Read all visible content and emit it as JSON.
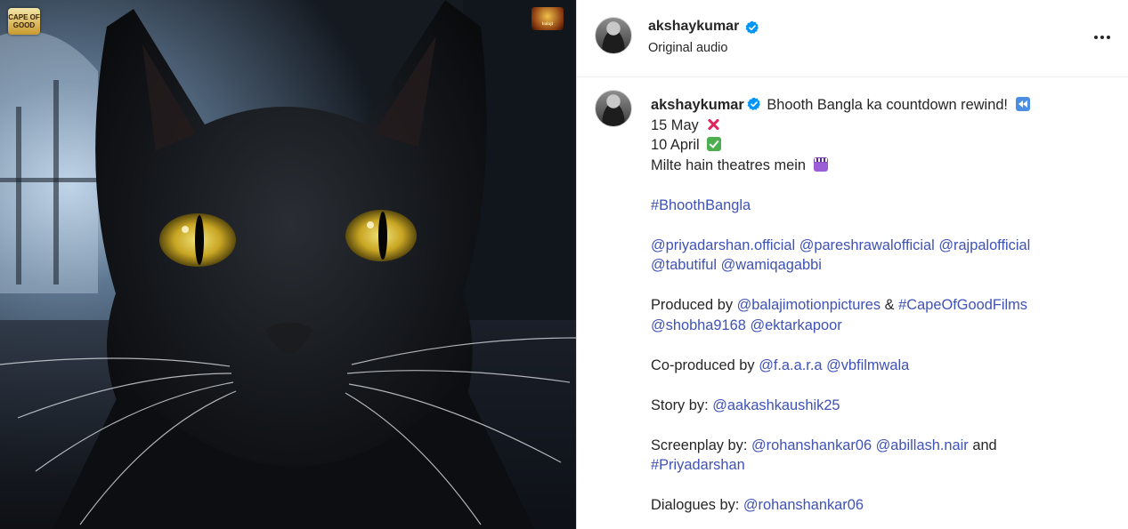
{
  "post": {
    "media": {
      "logo_left_text": "CAPE OF GOOD",
      "logo_right_text": "balaji"
    },
    "header": {
      "username": "akshaykumar",
      "verified_icon": "verified-badge-icon",
      "audio_label": "Original audio",
      "more_icon": "more-options-icon"
    },
    "caption": {
      "username": "akshaykumar",
      "first_line_text": "Bhooth Bangla ka countdown rewind!",
      "date_old": "15 May",
      "date_new": "10 April",
      "cta": "Milte hain theatres mein",
      "hashtag_main": "#BhoothBangla",
      "mentions_1": [
        "@priyadarshan.official",
        "@pareshrawalofficial",
        "@rajpalofficial"
      ],
      "mentions_2": [
        "@tabutiful",
        "@wamiqagabbi"
      ],
      "produced_label": "Produced by",
      "produced_by": [
        "@balajimotionpictures",
        "#CapeOfGoodFilms"
      ],
      "produced_amp": "&",
      "produced_by_2": [
        "@shobha9168",
        "@ektarkapoor"
      ],
      "coproduced_label": "Co-produced by",
      "coproduced_by": [
        "@f.a.a.r.a",
        "@vbfilmwala"
      ],
      "story_label": "Story by:",
      "story_by": "@aakashkaushik25",
      "screenplay_label": "Screenplay by:",
      "screenplay_by": [
        "@rohanshankar06",
        "@abillash.nair"
      ],
      "screenplay_and": "and",
      "screenplay_by_2": "#Priyadarshan",
      "dialogues_label": "Dialogues by:",
      "dialogues_by": "@rohanshankar06",
      "emoji_icons": [
        "rewind-emoji-icon",
        "cross-mark-emoji-icon",
        "check-mark-emoji-icon",
        "clapper-board-emoji-icon"
      ]
    },
    "colors": {
      "link": "#3f52b5",
      "text": "#262626",
      "verified": "#0095f6"
    }
  }
}
